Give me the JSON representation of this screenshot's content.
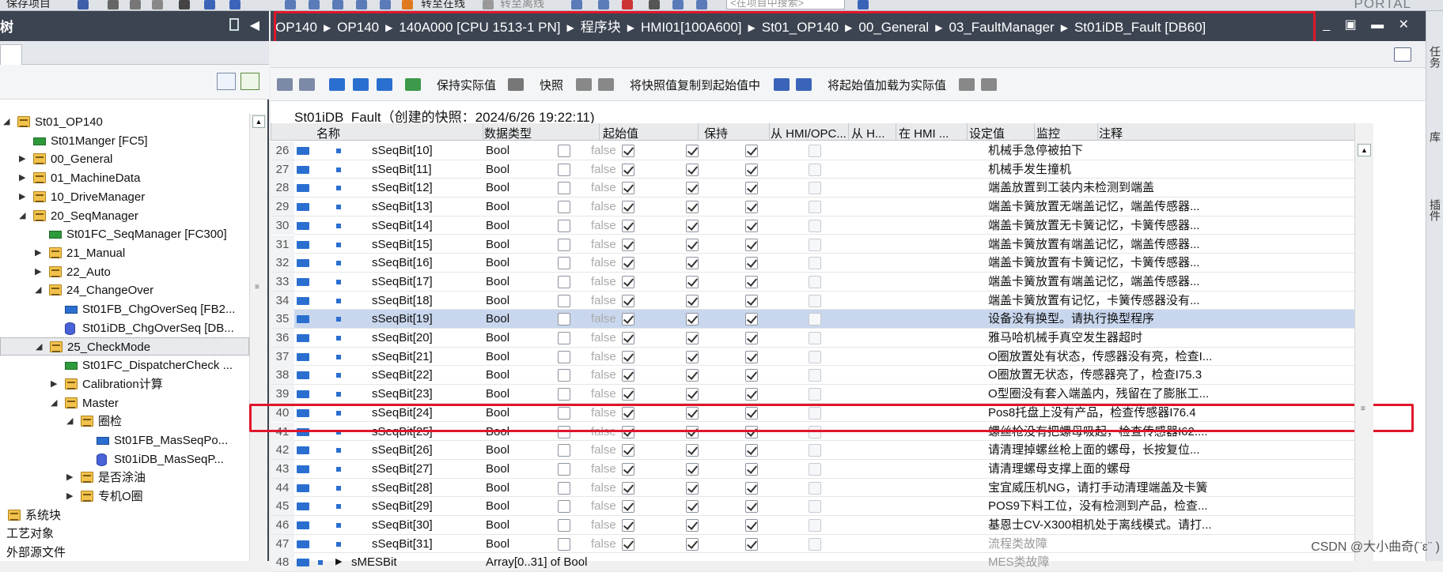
{
  "toolbar": {
    "save_project": "保存项目",
    "go_online": "转至在线",
    "go_offline": "转至离线",
    "search_placeholder": "<在项目中搜索>",
    "portal": "PORTAL"
  },
  "left_panel": {
    "header": "树",
    "tree": [
      {
        "label": "St01_OP140",
        "icon": "folder",
        "level": 0,
        "state": "expanded"
      },
      {
        "label": "St01Manger [FC5]",
        "icon": "fc",
        "level": 1,
        "state": "leaf"
      },
      {
        "label": "00_General",
        "icon": "folder",
        "level": 1,
        "state": "collapsed"
      },
      {
        "label": "01_MachineData",
        "icon": "folder",
        "level": 1,
        "state": "collapsed"
      },
      {
        "label": "10_DriveManager",
        "icon": "folder",
        "level": 1,
        "state": "collapsed"
      },
      {
        "label": "20_SeqManager",
        "icon": "folder",
        "level": 1,
        "state": "expanded"
      },
      {
        "label": "St01FC_SeqManager [FC300]",
        "icon": "fc",
        "level": 2,
        "state": "leaf"
      },
      {
        "label": "21_Manual",
        "icon": "folder",
        "level": 2,
        "state": "collapsed"
      },
      {
        "label": "22_Auto",
        "icon": "folder",
        "level": 2,
        "state": "collapsed"
      },
      {
        "label": "24_ChangeOver",
        "icon": "folder",
        "level": 2,
        "state": "expanded"
      },
      {
        "label": "St01FB_ChgOverSeq [FB2...",
        "icon": "fb",
        "level": 3,
        "state": "leaf"
      },
      {
        "label": "St01iDB_ChgOverSeq [DB...",
        "icon": "db",
        "level": 3,
        "state": "leaf"
      },
      {
        "label": "25_CheckMode",
        "icon": "folder",
        "level": 2,
        "state": "expanded",
        "selected": true
      },
      {
        "label": "St01FC_DispatcherCheck ...",
        "icon": "fc",
        "level": 3,
        "state": "leaf"
      },
      {
        "label": "Calibration计算",
        "icon": "folder",
        "level": 3,
        "state": "collapsed"
      },
      {
        "label": "Master",
        "icon": "folder",
        "level": 3,
        "state": "expanded"
      },
      {
        "label": "圈检",
        "icon": "folder",
        "level": 4,
        "state": "expanded"
      },
      {
        "label": "St01FB_MasSeqPo...",
        "icon": "fb",
        "level": 5,
        "state": "leaf"
      },
      {
        "label": "St01iDB_MasSeqP...",
        "icon": "db",
        "level": 5,
        "state": "leaf"
      },
      {
        "label": "是否涂油",
        "icon": "folder",
        "level": 4,
        "state": "collapsed"
      },
      {
        "label": "专机O圈",
        "icon": "folder",
        "level": 4,
        "state": "collapsed"
      },
      {
        "label": "系统块",
        "icon": "folder",
        "level": -1,
        "state": "collapsed"
      },
      {
        "label": "工艺对象",
        "icon": "none",
        "level": -1,
        "state": "leaf"
      },
      {
        "label": "外部源文件",
        "icon": "none",
        "level": -1,
        "state": "leaf"
      }
    ]
  },
  "breadcrumb": [
    "OP140",
    "OP140",
    "140A000 [CPU 1513-1 PN]",
    "程序块",
    "HMI01[100A600]",
    "St01_OP140",
    "00_General",
    "03_FaultManager",
    "St01iDB_Fault [DB60]"
  ],
  "window_controls": "_▪▪✕",
  "editor_toolbar": {
    "keep_actual": "保持实际值",
    "snapshot": "快照",
    "copy_snapshot": "将快照值复制到起始值中",
    "load_start": "将起始值加载为实际值"
  },
  "snapshot_title": "St01iDB_Fault（创建的快照：2024/6/26 19:22:11)",
  "columns": [
    "名称",
    "数据类型",
    "起始值",
    "保持",
    "从 HMI/OPC...",
    "从 H...",
    "在 HMI ...",
    "设定值",
    "监控",
    "注释"
  ],
  "rows": [
    {
      "num": "26",
      "name": "sSeqBit[10]",
      "type": "Bool",
      "start": "false",
      "comment": "机械手急停被拍下"
    },
    {
      "num": "27",
      "name": "sSeqBit[11]",
      "type": "Bool",
      "start": "false",
      "comment": "机械手发生撞机"
    },
    {
      "num": "28",
      "name": "sSeqBit[12]",
      "type": "Bool",
      "start": "false",
      "comment": "端盖放置到工装内未检测到端盖"
    },
    {
      "num": "29",
      "name": "sSeqBit[13]",
      "type": "Bool",
      "start": "false",
      "comment": "端盖卡簧放置无端盖记忆，端盖传感器..."
    },
    {
      "num": "30",
      "name": "sSeqBit[14]",
      "type": "Bool",
      "start": "false",
      "comment": "端盖卡簧放置无卡簧记忆，卡簧传感器..."
    },
    {
      "num": "31",
      "name": "sSeqBit[15]",
      "type": "Bool",
      "start": "false",
      "comment": "端盖卡簧放置有端盖记忆，端盖传感器..."
    },
    {
      "num": "32",
      "name": "sSeqBit[16]",
      "type": "Bool",
      "start": "false",
      "comment": "端盖卡簧放置有卡簧记忆，卡簧传感器..."
    },
    {
      "num": "33",
      "name": "sSeqBit[17]",
      "type": "Bool",
      "start": "false",
      "comment": "端盖卡簧放置有端盖记忆，端盖传感器..."
    },
    {
      "num": "34",
      "name": "sSeqBit[18]",
      "type": "Bool",
      "start": "false",
      "comment": "端盖卡簧放置有记忆，卡簧传感器没有..."
    },
    {
      "num": "35",
      "name": "sSeqBit[19]",
      "type": "Bool",
      "start": "false",
      "comment": "设备没有换型。请执行换型程序",
      "highlight": true
    },
    {
      "num": "36",
      "name": "sSeqBit[20]",
      "type": "Bool",
      "start": "false",
      "comment": "雅马哈机械手真空发生器超时"
    },
    {
      "num": "37",
      "name": "sSeqBit[21]",
      "type": "Bool",
      "start": "false",
      "comment": "O圈放置处有状态，传感器没有亮，检查I..."
    },
    {
      "num": "38",
      "name": "sSeqBit[22]",
      "type": "Bool",
      "start": "false",
      "comment": "O圈放置无状态，传感器亮了，检查I75.3"
    },
    {
      "num": "39",
      "name": "sSeqBit[23]",
      "type": "Bool",
      "start": "false",
      "comment": "O型圈没有套入端盖内，残留在了膨胀工..."
    },
    {
      "num": "40",
      "name": "sSeqBit[24]",
      "type": "Bool",
      "start": "false",
      "comment": "Pos8托盘上没有产品，检查传感器I76.4"
    },
    {
      "num": "41",
      "name": "sSeqBit[25]",
      "type": "Bool",
      "start": "false",
      "comment": "螺丝枪没有把螺母吸起，检查传感器I62...."
    },
    {
      "num": "42",
      "name": "sSeqBit[26]",
      "type": "Bool",
      "start": "false",
      "comment": "请清理掉螺丝枪上面的螺母，长按复位..."
    },
    {
      "num": "43",
      "name": "sSeqBit[27]",
      "type": "Bool",
      "start": "false",
      "comment": "请清理螺母支撑上面的螺母"
    },
    {
      "num": "44",
      "name": "sSeqBit[28]",
      "type": "Bool",
      "start": "false",
      "comment": "宝宜威压机NG，请打手动清理端盖及卡簧"
    },
    {
      "num": "45",
      "name": "sSeqBit[29]",
      "type": "Bool",
      "start": "false",
      "comment": "POS9下料工位，没有检测到产品，检查..."
    },
    {
      "num": "46",
      "name": "sSeqBit[30]",
      "type": "Bool",
      "start": "false",
      "comment": "基恩士CV-X300相机处于离线模式。请打..."
    },
    {
      "num": "47",
      "name": "sSeqBit[31]",
      "type": "Bool",
      "start": "false",
      "comment": "流程类故障",
      "grey": true
    },
    {
      "num": "48",
      "name": "sMESBit",
      "type": "Array[0..31] of Bool",
      "start": "",
      "comment": "MES类故障",
      "grey": true,
      "struct": true
    }
  ],
  "right_strip": [
    "任务",
    "库",
    "插件"
  ],
  "watermark": "CSDN @大小曲奇(¨ε¨ )"
}
